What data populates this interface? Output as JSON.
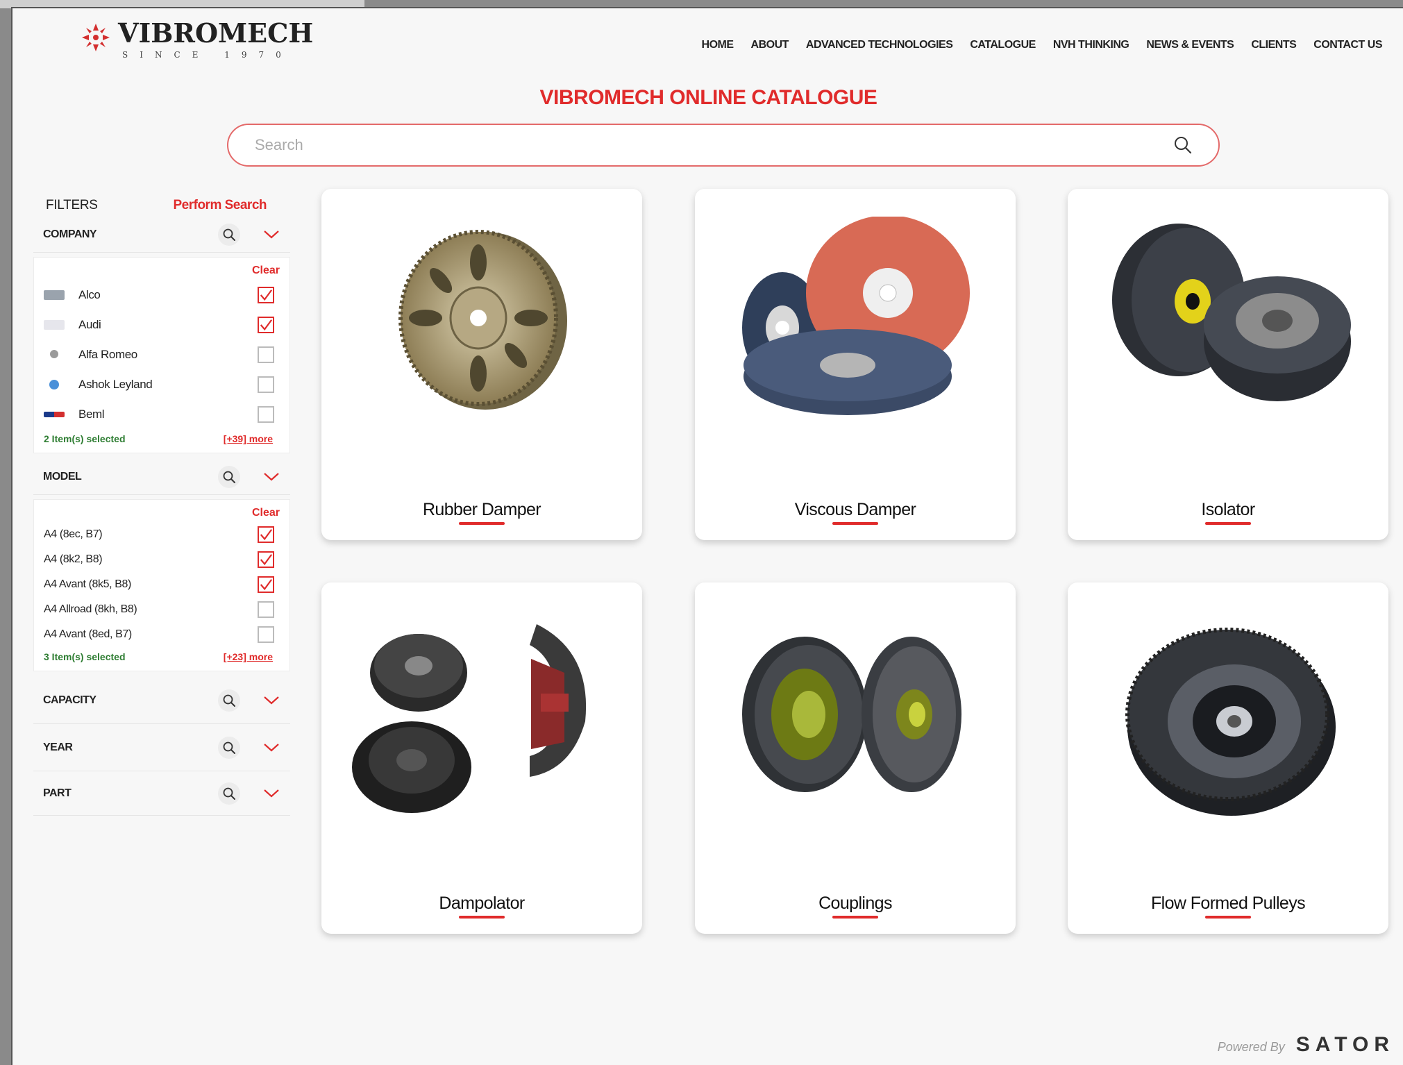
{
  "brand": {
    "name": "VIBROMECH",
    "since": "SINCE 1970"
  },
  "nav": [
    "HOME",
    "ABOUT",
    "ADVANCED TECHNOLOGIES",
    "CATALOGUE",
    "NVH THINKING",
    "NEWS & EVENTS",
    "CLIENTS",
    "CONTACT US"
  ],
  "page_title": "VIBROMECH ONLINE CATALOGUE",
  "search": {
    "placeholder": "Search",
    "value": ""
  },
  "filters": {
    "label": "FILTERS",
    "perform_search": "Perform Search",
    "company": {
      "title": "COMPANY",
      "clear": "Clear",
      "items": [
        {
          "label": "Alco",
          "checked": true
        },
        {
          "label": "Audi",
          "checked": true
        },
        {
          "label": "Alfa Romeo",
          "checked": false
        },
        {
          "label": "Ashok Leyland",
          "checked": false
        },
        {
          "label": "Beml",
          "checked": false
        }
      ],
      "selected": "2 Item(s) selected",
      "more": "[+39] more"
    },
    "model": {
      "title": "MODEL",
      "clear": "Clear",
      "items": [
        {
          "label": "A4 (8ec, B7)",
          "checked": true
        },
        {
          "label": "A4 (8k2, B8)",
          "checked": true
        },
        {
          "label": "A4 Avant (8k5, B8)",
          "checked": true
        },
        {
          "label": "A4 Allroad (8kh, B8)",
          "checked": false
        },
        {
          "label": "A4 Avant (8ed, B7)",
          "checked": false
        }
      ],
      "selected": "3 Item(s) selected",
      "more": "[+23] more"
    },
    "capacity": {
      "title": "CAPACITY"
    },
    "year": {
      "title": "YEAR"
    },
    "part": {
      "title": "PART"
    }
  },
  "products": [
    {
      "title": "Rubber Damper"
    },
    {
      "title": "Viscous Damper"
    },
    {
      "title": "Isolator"
    },
    {
      "title": "Dampolator"
    },
    {
      "title": "Couplings"
    },
    {
      "title": "Flow Formed Pulleys"
    }
  ],
  "footer": {
    "powered_by": "Powered By",
    "brand": "SATOR"
  },
  "colors": {
    "accent": "#e02b2b",
    "selected_green": "#2e7d32"
  }
}
